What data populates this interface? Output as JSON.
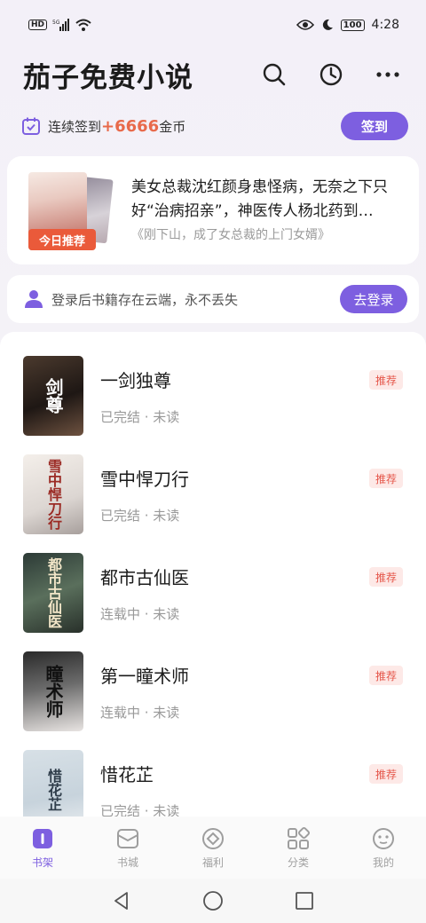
{
  "status_bar": {
    "hd_badge": "HD",
    "network": "5G",
    "battery": "100",
    "time": "4:28"
  },
  "header": {
    "title": "茄子免费小说",
    "icons": [
      "search-icon",
      "history-clock-icon",
      "more-icon"
    ]
  },
  "signin": {
    "prefix": "连续签到",
    "amount": "+6666",
    "suffix": "金币",
    "button": "签到"
  },
  "recommend": {
    "tag": "今日推荐",
    "description": "美女总裁沈红颜身患怪病，无奈之下只好“治病招亲”，神医传人杨北药到…",
    "source": "《刚下山，成了女总裁的上门女婿》"
  },
  "login": {
    "text": "登录后书籍存在云端，永不丢失",
    "button": "去登录"
  },
  "books": [
    {
      "title": "一剑独尊",
      "status": "已完结 · 未读",
      "badge": "推荐",
      "cover_text": "剑尊"
    },
    {
      "title": "雪中悍刀行",
      "status": "已完结 · 未读",
      "badge": "推荐",
      "cover_text": "雪中悍刀行"
    },
    {
      "title": "都市古仙医",
      "status": "连载中 · 未读",
      "badge": "推荐",
      "cover_text": "都市古仙医"
    },
    {
      "title": "第一瞳术师",
      "status": "连载中 · 未读",
      "badge": "推荐",
      "cover_text": "瞳术师"
    },
    {
      "title": "惜花芷",
      "status": "已完结 · 未读",
      "badge": "推荐",
      "cover_text": "惜花芷"
    }
  ],
  "tabs": [
    {
      "label": "书架",
      "icon": "bookshelf-icon",
      "active": true
    },
    {
      "label": "书城",
      "icon": "bookstore-icon",
      "active": false
    },
    {
      "label": "福利",
      "icon": "welfare-icon",
      "active": false
    },
    {
      "label": "分类",
      "icon": "category-icon",
      "active": false
    },
    {
      "label": "我的",
      "icon": "profile-icon",
      "active": false
    }
  ],
  "colors": {
    "accent": "#7d5fe0",
    "coin": "#e86a4b",
    "badge_bg": "#fde9e7",
    "badge_text": "#e5564a"
  }
}
